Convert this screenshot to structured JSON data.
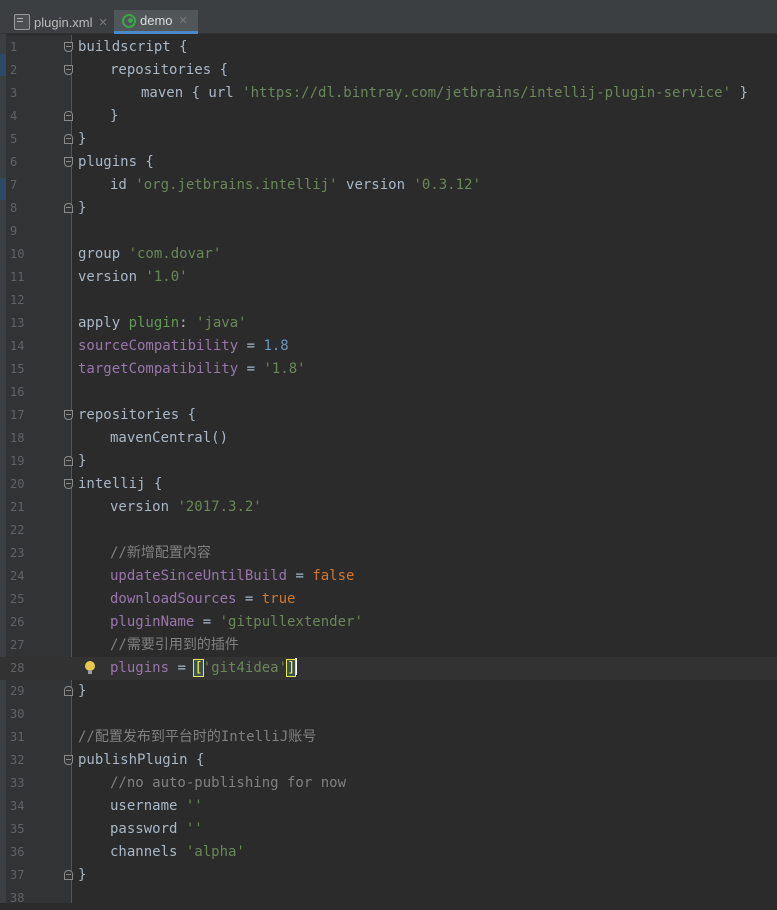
{
  "tabs": [
    {
      "label": "plugin.xml",
      "icon": "xml-file-icon",
      "active": false
    },
    {
      "label": "demo",
      "icon": "gradle-icon",
      "active": true
    }
  ],
  "colors": {
    "background": "#2b2b2b",
    "string": "#6a8759",
    "keyword": "#cc7832",
    "property": "#9876aa",
    "number": "#6897bb",
    "comment": "#808080"
  },
  "current_line": 28,
  "lines": [
    {
      "n": "1",
      "segs": [
        [
          "buildscript {",
          ""
        ]
      ]
    },
    {
      "n": "2",
      "segs": [
        [
          "repositories {",
          ""
        ]
      ]
    },
    {
      "n": "3",
      "segs": [
        [
          "maven { url ",
          ""
        ],
        [
          "'https://dl.bintray.com/jetbrains/intellij-plugin-service'",
          "str"
        ],
        [
          " }",
          ""
        ]
      ]
    },
    {
      "n": "4",
      "segs": [
        [
          "}",
          ""
        ]
      ]
    },
    {
      "n": "5",
      "segs": [
        [
          "}",
          ""
        ]
      ]
    },
    {
      "n": "6",
      "segs": [
        [
          "plugins {",
          ""
        ]
      ]
    },
    {
      "n": "7",
      "segs": [
        [
          "id ",
          ""
        ],
        [
          "'org.jetbrains.intellij'",
          "str"
        ],
        [
          " version ",
          ""
        ],
        [
          "'0.3.12'",
          "str"
        ]
      ]
    },
    {
      "n": "8",
      "segs": [
        [
          "}",
          ""
        ]
      ]
    },
    {
      "n": "9",
      "segs": []
    },
    {
      "n": "10",
      "segs": [
        [
          "group ",
          ""
        ],
        [
          "'com.dovar'",
          "str"
        ]
      ]
    },
    {
      "n": "11",
      "segs": [
        [
          "version ",
          ""
        ],
        [
          "'1.0'",
          "str"
        ]
      ]
    },
    {
      "n": "12",
      "segs": []
    },
    {
      "n": "13",
      "segs": [
        [
          "apply ",
          ""
        ],
        [
          "plugin",
          "grn"
        ],
        [
          ": ",
          ""
        ],
        [
          "'java'",
          "str"
        ]
      ]
    },
    {
      "n": "14",
      "segs": [
        [
          "sourceCompatibility",
          "prop"
        ],
        [
          " = ",
          ""
        ],
        [
          "1.8",
          "num"
        ]
      ]
    },
    {
      "n": "15",
      "segs": [
        [
          "targetCompatibility",
          "prop"
        ],
        [
          " = ",
          ""
        ],
        [
          "'1.8'",
          "str"
        ]
      ]
    },
    {
      "n": "16",
      "segs": []
    },
    {
      "n": "17",
      "segs": [
        [
          "repositories {",
          ""
        ]
      ]
    },
    {
      "n": "18",
      "segs": [
        [
          "mavenCentral()",
          ""
        ]
      ]
    },
    {
      "n": "19",
      "segs": [
        [
          "}",
          ""
        ]
      ]
    },
    {
      "n": "20",
      "segs": [
        [
          "intellij {",
          ""
        ]
      ]
    },
    {
      "n": "21",
      "segs": [
        [
          "version ",
          ""
        ],
        [
          "'2017.3.2'",
          "str"
        ]
      ]
    },
    {
      "n": "22",
      "segs": []
    },
    {
      "n": "23",
      "segs": [
        [
          "//新增配置内容",
          "cmt"
        ]
      ]
    },
    {
      "n": "24",
      "segs": [
        [
          "updateSinceUntilBuild",
          "prop"
        ],
        [
          " = ",
          ""
        ],
        [
          "false",
          "kw"
        ]
      ]
    },
    {
      "n": "25",
      "segs": [
        [
          "downloadSources",
          "prop"
        ],
        [
          " = ",
          ""
        ],
        [
          "true",
          "kw"
        ]
      ]
    },
    {
      "n": "26",
      "segs": [
        [
          "pluginName",
          "prop"
        ],
        [
          " = ",
          ""
        ],
        [
          "'gitpullextender'",
          "str"
        ]
      ]
    },
    {
      "n": "27",
      "segs": [
        [
          "//需要引用到的插件",
          "cmt"
        ]
      ]
    },
    {
      "n": "28",
      "segs": [
        [
          "plugins",
          "prop"
        ],
        [
          " = ",
          ""
        ],
        [
          "[",
          "brk"
        ],
        [
          "'git4idea'",
          "str"
        ],
        [
          "]",
          "brk"
        ]
      ]
    },
    {
      "n": "29",
      "segs": [
        [
          "}",
          ""
        ]
      ]
    },
    {
      "n": "30",
      "segs": []
    },
    {
      "n": "31",
      "segs": [
        [
          "//配置发布到平台时的IntelliJ账号",
          "cmt"
        ]
      ]
    },
    {
      "n": "32",
      "segs": [
        [
          "publishPlugin {",
          ""
        ]
      ]
    },
    {
      "n": "33",
      "segs": [
        [
          "//no auto-publishing for now",
          "cmt"
        ]
      ]
    },
    {
      "n": "34",
      "segs": [
        [
          "username ",
          ""
        ],
        [
          "''",
          "str"
        ]
      ]
    },
    {
      "n": "35",
      "segs": [
        [
          "password ",
          ""
        ],
        [
          "''",
          "str"
        ]
      ]
    },
    {
      "n": "36",
      "segs": [
        [
          "channels ",
          ""
        ],
        [
          "'alpha'",
          "str"
        ]
      ]
    },
    {
      "n": "37",
      "segs": [
        [
          "}",
          ""
        ]
      ]
    },
    {
      "n": "38",
      "segs": []
    }
  ]
}
